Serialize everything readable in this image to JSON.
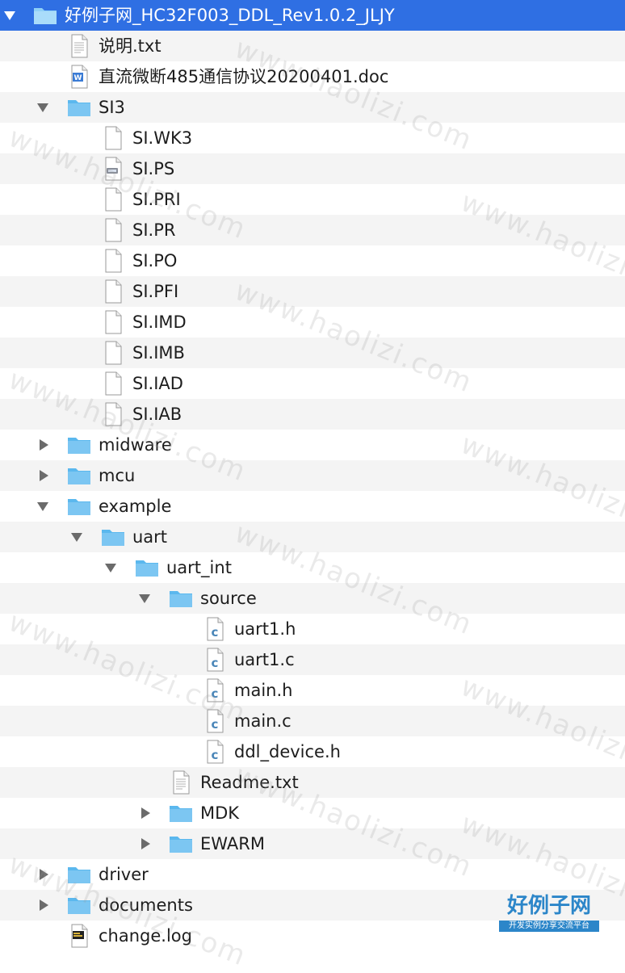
{
  "colors": {
    "selected_row": "#2f6fe3",
    "stripe": "#f4f4f4",
    "folder": "#5bb8ee",
    "c_badge": "#4a86b8"
  },
  "rows": [
    {
      "label": "好例子网_HC32F003_DDL_Rev1.0.2_JLJY",
      "type": "folder",
      "depth": 0,
      "expanded": true,
      "selected": true
    },
    {
      "label": "说明.txt",
      "type": "text",
      "depth": 1
    },
    {
      "label": "直流微断485通信协议20200401.doc",
      "type": "word",
      "depth": 1
    },
    {
      "label": "SI3",
      "type": "folder",
      "depth": 1,
      "expanded": true
    },
    {
      "label": "SI.WK3",
      "type": "blank",
      "depth": 2
    },
    {
      "label": "SI.PS",
      "type": "script",
      "depth": 2
    },
    {
      "label": "SI.PRI",
      "type": "blank",
      "depth": 2
    },
    {
      "label": "SI.PR",
      "type": "blank",
      "depth": 2
    },
    {
      "label": "SI.PO",
      "type": "blank",
      "depth": 2
    },
    {
      "label": "SI.PFI",
      "type": "blank",
      "depth": 2
    },
    {
      "label": "SI.IMD",
      "type": "blank",
      "depth": 2
    },
    {
      "label": "SI.IMB",
      "type": "blank",
      "depth": 2
    },
    {
      "label": "SI.IAD",
      "type": "blank",
      "depth": 2
    },
    {
      "label": "SI.IAB",
      "type": "blank",
      "depth": 2
    },
    {
      "label": "midware",
      "type": "folder",
      "depth": 1,
      "expanded": false
    },
    {
      "label": "mcu",
      "type": "folder",
      "depth": 1,
      "expanded": false
    },
    {
      "label": "example",
      "type": "folder",
      "depth": 1,
      "expanded": true
    },
    {
      "label": "uart",
      "type": "folder",
      "depth": 2,
      "expanded": true
    },
    {
      "label": "uart_int",
      "type": "folder",
      "depth": 3,
      "expanded": true
    },
    {
      "label": "source",
      "type": "folder",
      "depth": 4,
      "expanded": true
    },
    {
      "label": "uart1.h",
      "type": "c",
      "depth": 5
    },
    {
      "label": "uart1.c",
      "type": "c",
      "depth": 5
    },
    {
      "label": "main.h",
      "type": "c",
      "depth": 5
    },
    {
      "label": "main.c",
      "type": "c",
      "depth": 5
    },
    {
      "label": "ddl_device.h",
      "type": "c",
      "depth": 5
    },
    {
      "label": "Readme.txt",
      "type": "text",
      "depth": 4
    },
    {
      "label": "MDK",
      "type": "folder",
      "depth": 4,
      "expanded": false
    },
    {
      "label": "EWARM",
      "type": "folder",
      "depth": 4,
      "expanded": false
    },
    {
      "label": "driver",
      "type": "folder",
      "depth": 1,
      "expanded": false
    },
    {
      "label": "documents",
      "type": "folder",
      "depth": 1,
      "expanded": false
    },
    {
      "label": "change.log",
      "type": "log",
      "depth": 1
    }
  ],
  "watermark": "www.haolizi.com",
  "logo": {
    "title": "好例子网",
    "subtitle": "开发实例分享交流平台"
  }
}
